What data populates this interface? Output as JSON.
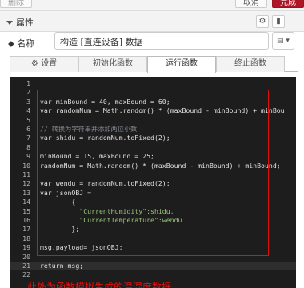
{
  "toolbar": {
    "delete_label": "删除",
    "cancel_label": "取消",
    "done_label": "完成"
  },
  "properties": {
    "title": "属性",
    "gear_icon": "gear-icon",
    "doc_icon": "document-icon"
  },
  "name_field": {
    "label": "名称",
    "value": "构造 [直连设备] 数据",
    "icon_picker": "▤ ▾"
  },
  "tabs": [
    {
      "label": "设置",
      "icon": "gear-icon",
      "active": false
    },
    {
      "label": "初始化函数",
      "active": false
    },
    {
      "label": "运行函数",
      "active": true
    },
    {
      "label": "终止函数",
      "active": false
    }
  ],
  "editor": {
    "line_numbers": [
      "1",
      "2",
      "3",
      "4",
      "5",
      "6",
      "7",
      "8",
      "9",
      "10",
      "11",
      "12",
      "13",
      "14",
      "15",
      "16",
      "17",
      "18",
      "19",
      "20",
      "21",
      "22"
    ],
    "lines": [
      "",
      "",
      "var minBound = 40, maxBound = 60;",
      "var randomNum = Math.random() * (maxBound - minBound) + minBou",
      "",
      "// 转换为字符串并添加两位小数",
      "var shidu = randomNum.toFixed(2);",
      "",
      "minBound = 15, maxBound = 25;",
      "randomNum = Math.random() * (maxBound - minBound) + minBound;",
      "",
      "var wendu = randomNum.toFixed(2);",
      "var jsonOBJ =",
      "        {",
      "          \"CurrentHumidity\":shidu,",
      "          \"CurrentTemperature\":wendu",
      "        };",
      "",
      "msg.payload= jsonOBJ;",
      "",
      "return msg;",
      ""
    ],
    "highlighted_line": 21
  },
  "annotation": "此处为函数模拟生成的温湿度数据"
}
